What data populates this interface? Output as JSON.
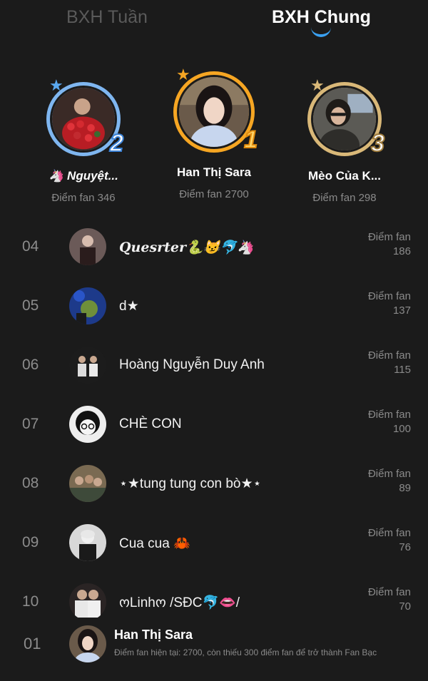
{
  "tabs": {
    "weekly": "BXH Tuần",
    "overall": "BXH Chung"
  },
  "podium": [
    {
      "rank_badge": "2",
      "name": "🦄 Nguyệt...",
      "score": "Điểm fan 346"
    },
    {
      "rank_badge": "1",
      "name": "Han Thị Sara",
      "score": "Điểm fan 2700"
    },
    {
      "rank_badge": "3",
      "name": "Mèo Của K...",
      "score": "Điểm fan 298"
    }
  ],
  "score_label": "Điểm fan",
  "rows": [
    {
      "rank": "04",
      "name": "Quesrter🐍😼🐬🦄",
      "score": "186"
    },
    {
      "rank": "05",
      "name": "d★",
      "score": "137"
    },
    {
      "rank": "06",
      "name": "Hoàng Nguyễn Duy Anh",
      "score": "115"
    },
    {
      "rank": "07",
      "name": "CHÈ CON",
      "score": "100"
    },
    {
      "rank": "08",
      "name": "⋆★tung tung con bò★⋆",
      "score": "89"
    },
    {
      "rank": "09",
      "name": "Cua cua 🦀",
      "score": "76"
    },
    {
      "rank": "10",
      "name": "ოLinhო /SĐC🐬👄/",
      "score": "70"
    }
  ],
  "self": {
    "rank": "01",
    "name": "Han Thị Sara",
    "info": "Điểm fan hiện tại: 2700, còn thiếu 300 điểm fan để trở thành Fan Bạc"
  },
  "colors": {
    "background": "#1b1b1b",
    "tab_accent": "#3aa0f0",
    "gold": "#f6a623",
    "silver": "#7fb6f0",
    "bronze": "#d9b878"
  }
}
